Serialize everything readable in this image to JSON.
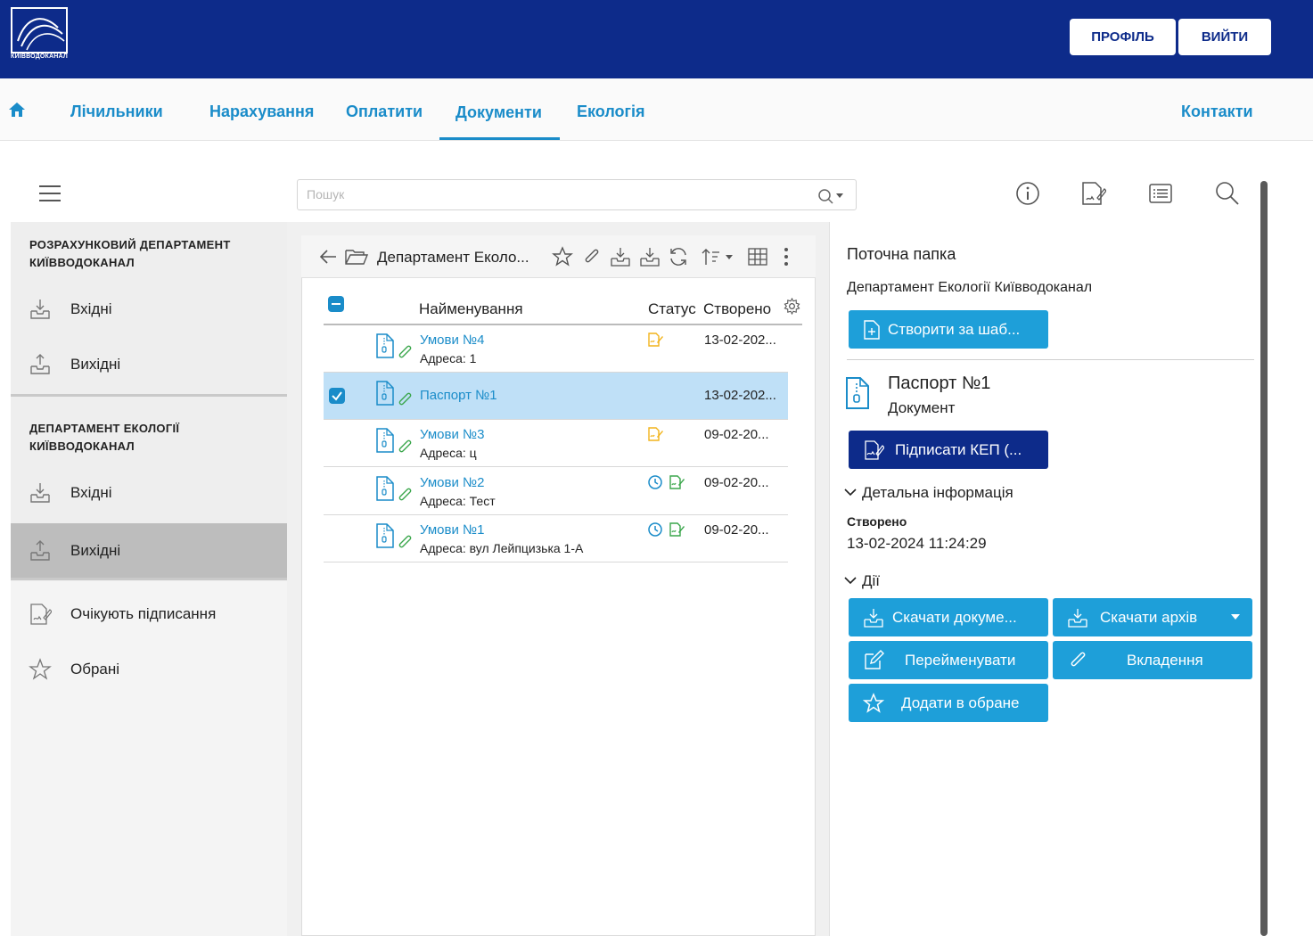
{
  "header": {
    "logo_text": "КИЇВВОДОКАНАЛ",
    "profile_label": "ПРОФІЛЬ",
    "logout_label": "ВИЙТИ"
  },
  "nav": {
    "items": [
      "Лічильники",
      "Нарахування",
      "Оплатити",
      "Документи",
      "Екологія"
    ],
    "active": "Документи",
    "contacts": "Контакти"
  },
  "search": {
    "placeholder": "Пошук"
  },
  "sidebar": {
    "sections": [
      {
        "title": "РОЗРАХУНКОВИЙ ДЕПАРТАМЕНТ КИЇВВОДОКАНАЛ",
        "items": [
          {
            "label": "Вхідні",
            "icon": "inbox-download-icon"
          },
          {
            "label": "Вихідні",
            "icon": "outbox-upload-icon"
          }
        ]
      },
      {
        "title": "ДЕПАРТАМЕНТ ЕКОЛОГІЇ КИЇВВОДОКАНАЛ",
        "items": [
          {
            "label": "Вхідні",
            "icon": "inbox-download-icon"
          },
          {
            "label": "Вихідні",
            "icon": "outbox-upload-icon",
            "active": true
          }
        ]
      }
    ],
    "extra_items": [
      {
        "label": "Очікують підписання",
        "icon": "sign-document-icon"
      },
      {
        "label": "Обрані",
        "icon": "star-icon"
      }
    ]
  },
  "folder": {
    "title": "Департамент Еколо..."
  },
  "table": {
    "columns": [
      "Найменування",
      "Статус",
      "Створено"
    ],
    "rows": [
      {
        "name": "Умови №4",
        "sub": "Адреса: 1",
        "status": [
          "pending-sign"
        ],
        "date": "13-02-202...",
        "selected": false
      },
      {
        "name": "Паспорт №1",
        "sub": "",
        "status": [],
        "date": "13-02-202...",
        "selected": true
      },
      {
        "name": "Умови №3",
        "sub": "Адреса: ц",
        "status": [
          "pending-sign"
        ],
        "date": "09-02-20...",
        "selected": false
      },
      {
        "name": "Умови №2",
        "sub": "Адреса: Тест",
        "status": [
          "clock",
          "signed"
        ],
        "date": "09-02-20...",
        "selected": false
      },
      {
        "name": "Умови №1",
        "sub": "Адреса: вул Лейпцизька 1-А",
        "status": [
          "clock",
          "signed"
        ],
        "date": "09-02-20...",
        "selected": false
      }
    ]
  },
  "details": {
    "current_folder_label": "Поточна папка",
    "current_folder_name": "Департамент Екології Київводоканал",
    "create_from_template": "Створити за шаб...",
    "doc_title": "Паспорт №1",
    "doc_type": "Документ",
    "sign_button": "Підписати КЕП (...",
    "detail_info_label": "Детальна інформація",
    "created_label": "Створено",
    "created_value": "13-02-2024 11:24:29",
    "actions_label": "Дії",
    "actions": {
      "download_doc": "Скачати докуме...",
      "download_archive": "Скачати архів",
      "rename": "Перейменувати",
      "attachments": "Вкладення",
      "add_favorite": "Додати в обране"
    }
  },
  "colors": {
    "header_bg": "#0d2b8a",
    "accent": "#1a8cc9",
    "button_blue": "#1e9fd9",
    "selected_row": "#bfe0f7",
    "status_yellow": "#f2b41c",
    "status_green": "#3aa64b"
  }
}
